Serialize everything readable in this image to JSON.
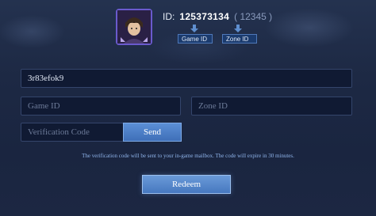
{
  "profile": {
    "id_label": "ID:",
    "id_value": "125373134",
    "zone_value": "( 12345 )",
    "game_id_tag": "Game ID",
    "zone_id_tag": "Zone ID"
  },
  "form": {
    "code_value": "3r83efok9",
    "game_id_placeholder": "Game ID",
    "zone_id_placeholder": "Zone ID",
    "verification_placeholder": "Verification Code",
    "send_label": "Send"
  },
  "note": "The verification code will be sent to your in-game mailbox. The code will expire in 30 minutes.",
  "redeem_label": "Redeem",
  "colors": {
    "accent": "#4f78b8",
    "button": "#4678bf",
    "note": "#8fb4ea"
  }
}
